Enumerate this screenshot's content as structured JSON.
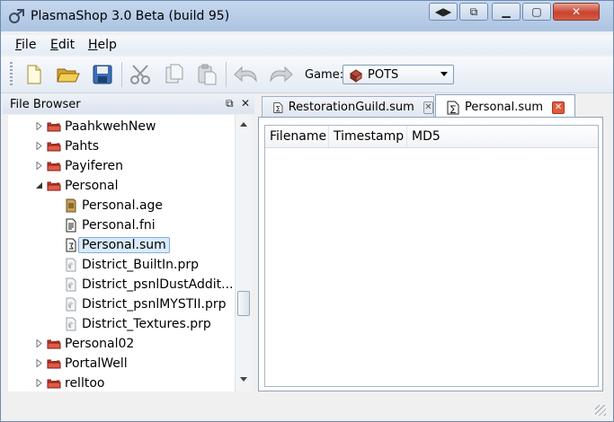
{
  "window": {
    "title": "PlasmaShop 3.0 Beta (build 95)"
  },
  "menu": [
    {
      "label": "File",
      "accel": "F",
      "rest": "ile"
    },
    {
      "label": "Edit",
      "accel": "E",
      "rest": "dit"
    },
    {
      "label": "Help",
      "accel": "H",
      "rest": "elp"
    }
  ],
  "toolbar": {
    "game_label": "Game:",
    "game_value": "POTS"
  },
  "file_browser": {
    "title": "File Browser",
    "items": [
      {
        "label": "PaahkwehNew",
        "type": "folder",
        "level": 0,
        "expanded": false
      },
      {
        "label": "Pahts",
        "type": "folder",
        "level": 0,
        "expanded": false
      },
      {
        "label": "Payiferen",
        "type": "folder",
        "level": 0,
        "expanded": false
      },
      {
        "label": "Personal",
        "type": "folder",
        "level": 0,
        "expanded": true
      },
      {
        "label": "Personal.age",
        "type": "age",
        "level": 1
      },
      {
        "label": "Personal.fni",
        "type": "fni",
        "level": 1
      },
      {
        "label": "Personal.sum",
        "type": "sum",
        "level": 1,
        "selected": true
      },
      {
        "label": "District_BuiltIn.prp",
        "type": "prp",
        "level": 1
      },
      {
        "label": "District_psnlDustAddit...",
        "type": "prp",
        "level": 1
      },
      {
        "label": "District_psnlMYSTII.prp",
        "type": "prp",
        "level": 1
      },
      {
        "label": "District_Textures.prp",
        "type": "prp",
        "level": 1
      },
      {
        "label": "Personal02",
        "type": "folder",
        "level": 0,
        "expanded": false
      },
      {
        "label": "PortalWell",
        "type": "folder",
        "level": 0,
        "expanded": false
      },
      {
        "label": "relltoo",
        "type": "folder",
        "level": 0,
        "expanded": false
      }
    ]
  },
  "tabs": [
    {
      "label": "RestorationGuild.sum",
      "active": false
    },
    {
      "label": "Personal.sum",
      "active": true
    }
  ],
  "table": {
    "columns": [
      "Filename",
      "Timestamp",
      "MD5"
    ]
  }
}
